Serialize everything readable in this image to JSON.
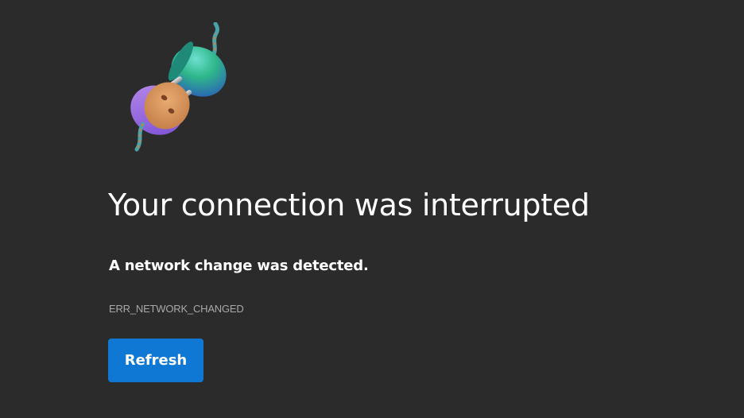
{
  "page": {
    "title": "Your connection was interrupted",
    "subtitle": "A network change was detected.",
    "error_code": "ERR_NETWORK_CHANGED",
    "illustration_icon": "unplugged-plug-icon"
  },
  "actions": {
    "refresh_label": "Refresh"
  },
  "colors": {
    "background": "#2b2b2b",
    "text": "#ffffff",
    "error_code": "#a8a8a8",
    "accent": "#0f78d4"
  }
}
